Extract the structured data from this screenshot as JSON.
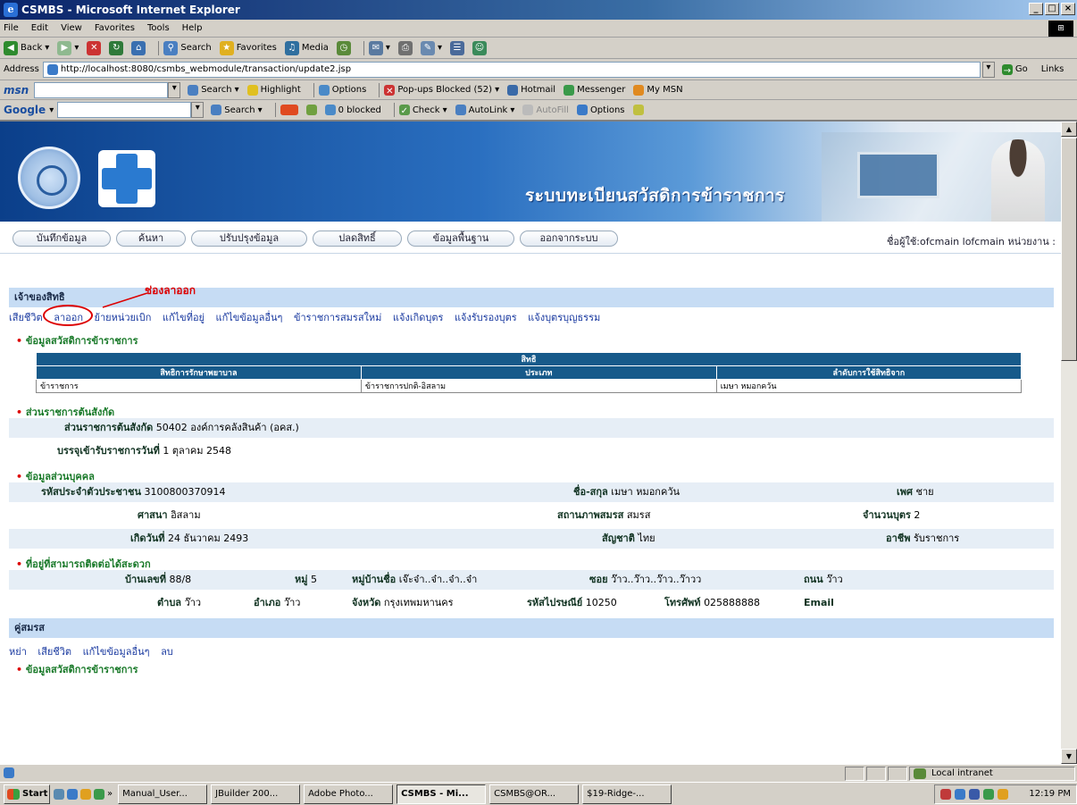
{
  "window": {
    "title": "CSMBS - Microsoft Internet Explorer"
  },
  "menu": [
    "File",
    "Edit",
    "View",
    "Favorites",
    "Tools",
    "Help"
  ],
  "toolbar": {
    "back": "Back",
    "search": "Search",
    "favorites": "Favorites",
    "media": "Media"
  },
  "address": {
    "label": "Address",
    "url": "http://localhost:8080/csmbs_webmodule/transaction/update2.jsp",
    "go": "Go",
    "links": "Links"
  },
  "msn": {
    "logo": "msn",
    "search": "Search",
    "highlight": "Highlight",
    "options": "Options",
    "popups": "Pop-ups Blocked (52)",
    "hotmail": "Hotmail",
    "messenger": "Messenger",
    "mymsn": "My MSN"
  },
  "google": {
    "logo": "Google",
    "search": "Search",
    "blocked": "0 blocked",
    "check": "Check",
    "autolink": "AutoLink",
    "autofill": "AutoFill",
    "options": "Options"
  },
  "banner": {
    "title": "ระบบทะเบียนสวัสดิการข้าราชการ"
  },
  "nav": {
    "items": [
      "บันทึกข้อมูล",
      "ค้นหา",
      "ปรับปรุงข้อมูล",
      "ปลดสิทธิ์",
      "ข้อมูลพื้นฐาน",
      "ออกจากระบบ"
    ],
    "user": "ชื่อผู้ใช้:ofcmain lofcmain หน่วยงาน :"
  },
  "owner": {
    "heading": "เจ้าของสิทธิ",
    "annotation": "ช่องลาออก",
    "links": [
      "เสียชีวิต",
      "ลาออก",
      "ย้ายหน่วยเบิก",
      "แก้ไขที่อยู่",
      "แก้ไขข้อมูลอื่นๆ",
      "ข้าราชการสมรสใหม่",
      "แจ้งเกิดบุตร",
      "แจ้งรับรองบุตร",
      "แจ้งบุตรบุญธรรม"
    ]
  },
  "welfare": {
    "heading": "ข้อมูลสวัสดิการข้าราชการ",
    "table": {
      "group": "สิทธิ",
      "columns": [
        "สิทธิการรักษาพยาบาล",
        "ประเภท",
        "ลำดับการใช้สิทธิจาก"
      ],
      "rows": [
        [
          "ข้าราชการ",
          "ข้าราชการปกติ-อิสลาม",
          "เมษา หมอกควัน"
        ]
      ]
    }
  },
  "agency": {
    "heading": "ส่วนราชการต้นสังกัด",
    "agency_label": "ส่วนราชการต้นสังกัด",
    "agency_value": "50402 องค์การคลังสินค้า (อคส.)",
    "date_label": "บรรจุเข้ารับราชการวันที่",
    "date_value": "1 ตุลาคม 2548"
  },
  "personal": {
    "heading": "ข้อมูลส่วนบุคคล",
    "id_label": "รหัสประจำตัวประชาชน",
    "id_value": "3100800370914",
    "name_label": "ชื่อ-สกุล",
    "name_value": "เมษา หมอกควัน",
    "sex_label": "เพศ",
    "sex_value": "ชาย",
    "religion_label": "ศาสนา",
    "religion_value": "อิสลาม",
    "marital_label": "สถานภาพสมรส",
    "marital_value": "สมรส",
    "children_label": "จำนวนบุตร",
    "children_value": "2",
    "birth_label": "เกิดวันที่",
    "birth_value": "24 ธันวาคม 2493",
    "nation_label": "สัญชาติ",
    "nation_value": "ไทย",
    "job_label": "อาชีพ",
    "job_value": "รับราชการ"
  },
  "address_info": {
    "heading": "ที่อยู่ที่สามารถติดต่อได้สะดวก",
    "house_label": "บ้านเลขที่",
    "house_value": "88/8",
    "moo_label": "หมู่",
    "moo_value": "5",
    "village_label": "หมู่บ้านชื่อ",
    "village_value": "เจ๊ะจ๋า..จ๋า..จ๋า..จ๋า",
    "soi_label": "ซอย",
    "soi_value": "ว๊าว..ว๊าว..ว๊าว..ว๊าวว",
    "road_label": "ถนน",
    "road_value": "ว๊าว",
    "tambon_label": "ตำบล",
    "tambon_value": "ว๊าว",
    "amphoe_label": "อำเภอ",
    "amphoe_value": "ว๊าว",
    "province_label": "จังหวัด",
    "province_value": "กรุงเทพมหานคร",
    "postal_label": "รหัสไปรษณีย์",
    "postal_value": "10250",
    "phone_label": "โทรศัพท์",
    "phone_value": "025888888",
    "email_label": "Email",
    "email_value": ""
  },
  "spouse": {
    "heading": "คู่สมรส",
    "links": [
      "หย่า",
      "เสียชีวิต",
      "แก้ไขข้อมูลอื่นๆ",
      "ลบ"
    ],
    "sub_heading": "ข้อมูลสวัสดิการข้าราชการ"
  },
  "status": {
    "zone": "Local intranet"
  },
  "taskbar": {
    "start": "Start",
    "tasks": [
      "Manual_User...",
      "JBuilder 200...",
      "Adobe Photo...",
      "CSMBS - Mi...",
      "CSMBS@OR...",
      "$19-Ridge-..."
    ],
    "time": "12:19 PM"
  }
}
